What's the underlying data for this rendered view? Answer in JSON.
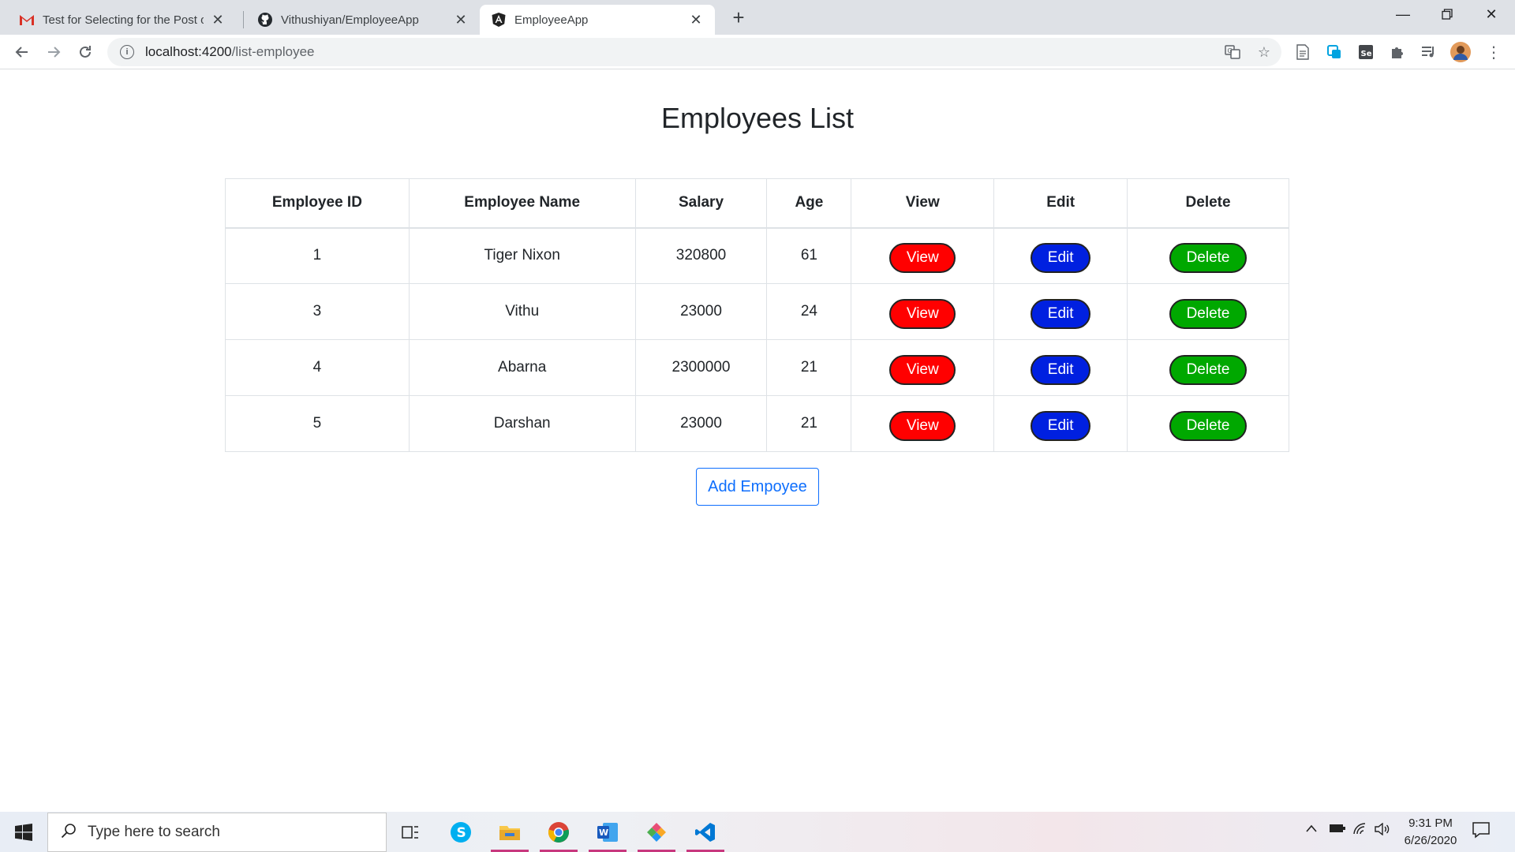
{
  "browser": {
    "tabs": [
      {
        "title": "Test for Selecting for the Post of",
        "active": false
      },
      {
        "title": "Vithushiyan/EmployeeApp",
        "active": false
      },
      {
        "title": "EmployeeApp",
        "active": true
      }
    ],
    "url_host": "localhost:4200",
    "url_path": "/list-employee"
  },
  "page": {
    "title": "Employees List",
    "columns": [
      "Employee ID",
      "Employee Name",
      "Salary",
      "Age",
      "View",
      "Edit",
      "Delete"
    ],
    "rows": [
      {
        "id": "1",
        "name": "Tiger Nixon",
        "salary": "320800",
        "age": "61"
      },
      {
        "id": "3",
        "name": "Vithu",
        "salary": "23000",
        "age": "24"
      },
      {
        "id": "4",
        "name": "Abarna",
        "salary": "2300000",
        "age": "21"
      },
      {
        "id": "5",
        "name": "Darshan",
        "salary": "23000",
        "age": "21"
      }
    ],
    "view_label": "View",
    "edit_label": "Edit",
    "delete_label": "Delete",
    "add_label": "Add Empoyee",
    "colors": {
      "view": "#ff0000",
      "edit": "#0020e0",
      "delete": "#00a800",
      "primary": "#0d6efd"
    }
  },
  "taskbar": {
    "search_placeholder": "Type here to search",
    "time": "9:31 PM",
    "date": "6/26/2020"
  }
}
